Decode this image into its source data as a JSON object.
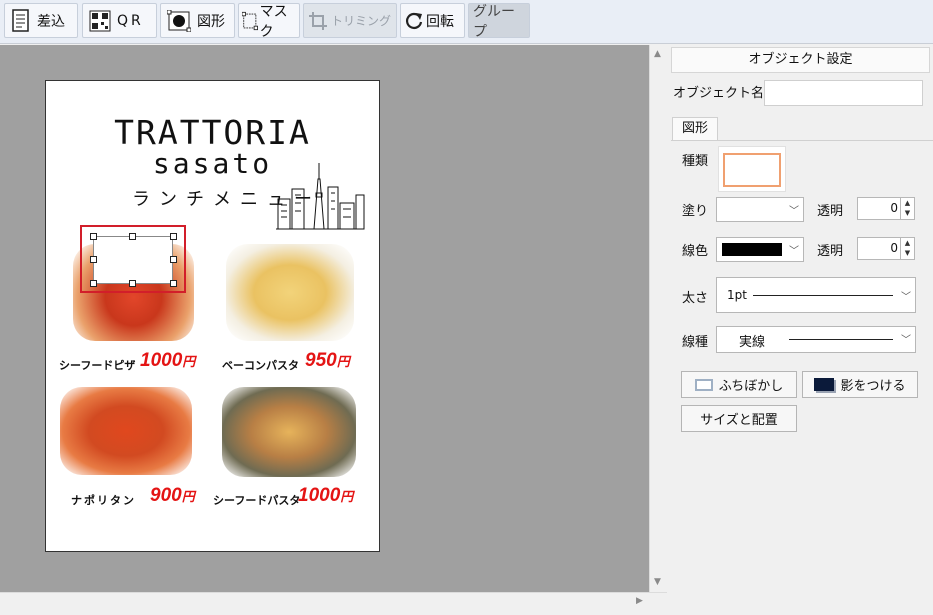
{
  "toolbar": {
    "insert_label": "差込",
    "qr_label": "QR",
    "shape_label": "図形",
    "mask_label": "マスク",
    "trim_label": "トリミング",
    "rotate_label": "回転",
    "group_label": "グループ"
  },
  "flyer": {
    "title_line1": "TRATTORIA",
    "title_line2": "sasato",
    "subtitle": "ランチメニュー",
    "items": [
      {
        "name": "シーフードピザ",
        "price": "1000",
        "yen": "円"
      },
      {
        "name": "ベーコンパスタ",
        "price": "950",
        "yen": "円"
      },
      {
        "name": "ナポリタン",
        "price": "900",
        "yen": "円"
      },
      {
        "name": "シーフードパスタ",
        "price": "1000",
        "yen": "円"
      }
    ]
  },
  "panel": {
    "title": "オブジェクト設定",
    "object_name_label": "オブジェクト名",
    "object_name_value": "",
    "tab_label": "図形",
    "kind_label": "種類",
    "fill_label": "塗り",
    "fill_alpha_label": "透明",
    "fill_alpha_value": "0",
    "line_color_label": "線色",
    "line_alpha_label": "透明",
    "line_alpha_value": "0",
    "thickness_label": "太さ",
    "thickness_value": "1pt",
    "line_type_label": "線種",
    "line_type_value": "実線",
    "blur_button": "ふちぼかし",
    "shadow_button": "影をつける",
    "size_button": "サイズと配置"
  },
  "colors": {
    "accent_red": "#e41414",
    "selection_red": "#d21e2a",
    "shape_outline": "#f0a070"
  }
}
